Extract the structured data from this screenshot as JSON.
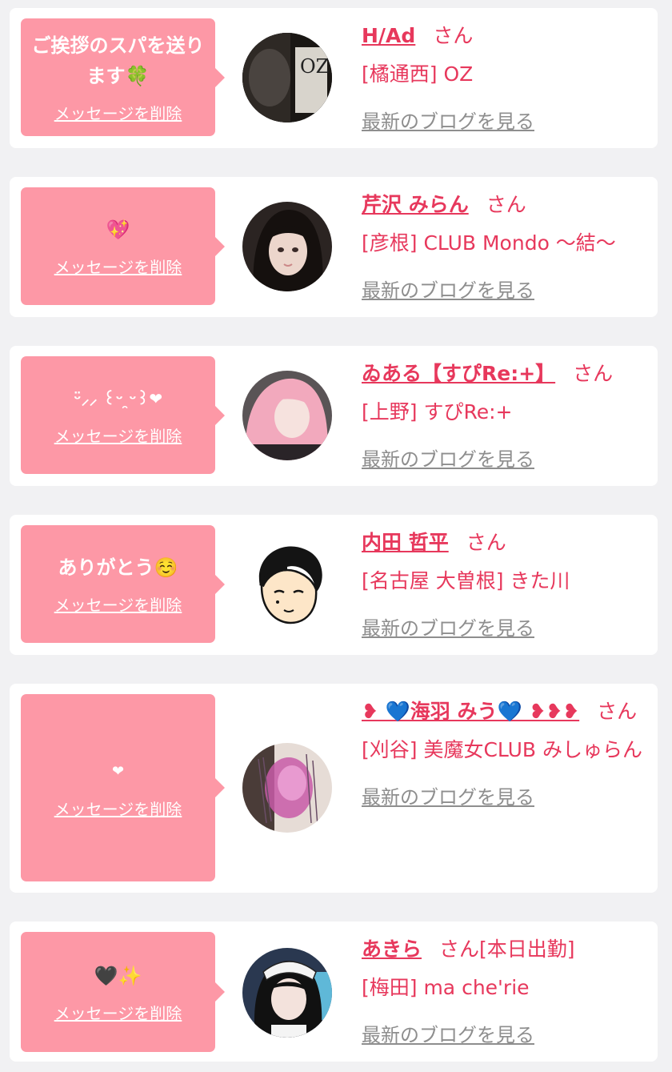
{
  "labels": {
    "delete": "メッセージを削除",
    "blog": "最新のブログを見る",
    "honorific": "さん"
  },
  "entries": [
    {
      "message": "ご挨拶のスパを送ります🍀",
      "name": "H/Ad",
      "status": "",
      "shop": "[橘通西] OZ",
      "avatar_text": "OZ"
    },
    {
      "message": "💖",
      "name": "芹沢 みらん",
      "status": "",
      "shop": "[彦根] CLUB Mondo 〜結〜",
      "avatar_text": ""
    },
    {
      "message": "ᵕ̈⸝⸝ ꒰ᵕ ̯ᵕ꒱❤",
      "name": "ゐある【すぴRe:+】",
      "status": "",
      "shop": "[上野] すぴRe:+",
      "avatar_text": ""
    },
    {
      "message": "ありがとう☺️",
      "name": "内田 哲平",
      "status": "",
      "shop": "[名古屋 大曽根] きた川",
      "avatar_text": ""
    },
    {
      "message": "❤",
      "name": "❥ 💙海羽 みう💙 ❥❥❥",
      "status": "",
      "shop": "[刈谷] 美魔女CLUB みしゅらん",
      "avatar_text": ""
    },
    {
      "message": "🖤✨",
      "name": "あきら",
      "status": "[本日出勤]",
      "shop": "[梅田] ma che'rie",
      "avatar_text": ""
    }
  ]
}
